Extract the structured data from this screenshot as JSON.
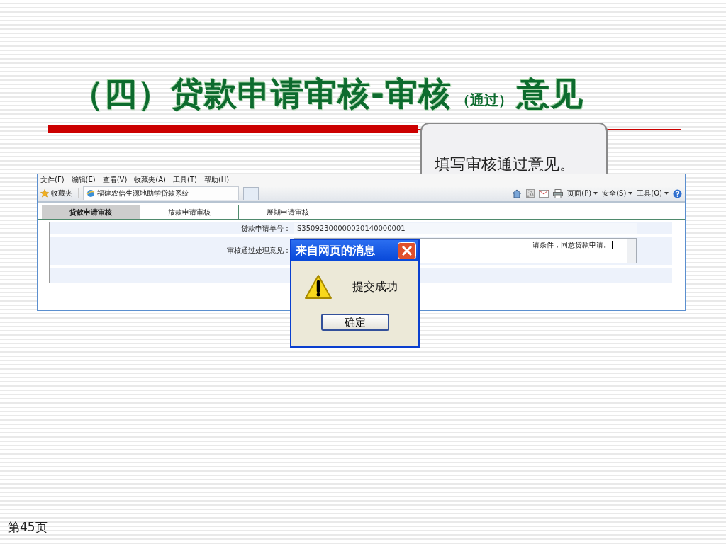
{
  "slide_title": {
    "main": "（四）贷款申请审核-审核",
    "note": "（通过）",
    "tail": "意见"
  },
  "callout": "填写审核通过意见。",
  "browser": {
    "menu": [
      "文件(F)",
      "编辑(E)",
      "查看(V)",
      "收藏夹(A)",
      "工具(T)",
      "帮助(H)"
    ],
    "favorites": "收藏夹",
    "tab_title": "福建农信生源地助学贷款系统",
    "toolbar": [
      {
        "kind": "home"
      },
      {
        "kind": "feed"
      },
      {
        "kind": "mail"
      },
      {
        "kind": "print"
      },
      {
        "kind": "menu",
        "label": "页面(P)"
      },
      {
        "kind": "menu",
        "label": "安全(S)"
      },
      {
        "kind": "menu",
        "label": "工具(O)"
      },
      {
        "kind": "help"
      }
    ]
  },
  "app_tabs": [
    {
      "label": "贷款申请审核",
      "selected": true
    },
    {
      "label": "放款申请审核",
      "selected": false
    },
    {
      "label": "展期申请审核",
      "selected": false
    }
  ],
  "form": [
    {
      "kind": "text",
      "label": "贷款申请单号：",
      "value": "S35092300000020140000001"
    },
    {
      "kind": "textarea",
      "label": "审核通过处理意见：",
      "value": "请条件，同意贷款申请。"
    }
  ],
  "dialog": {
    "title": "来自网页的消息",
    "message": "提交成功",
    "button": "确定"
  },
  "page_number": "第45页"
}
